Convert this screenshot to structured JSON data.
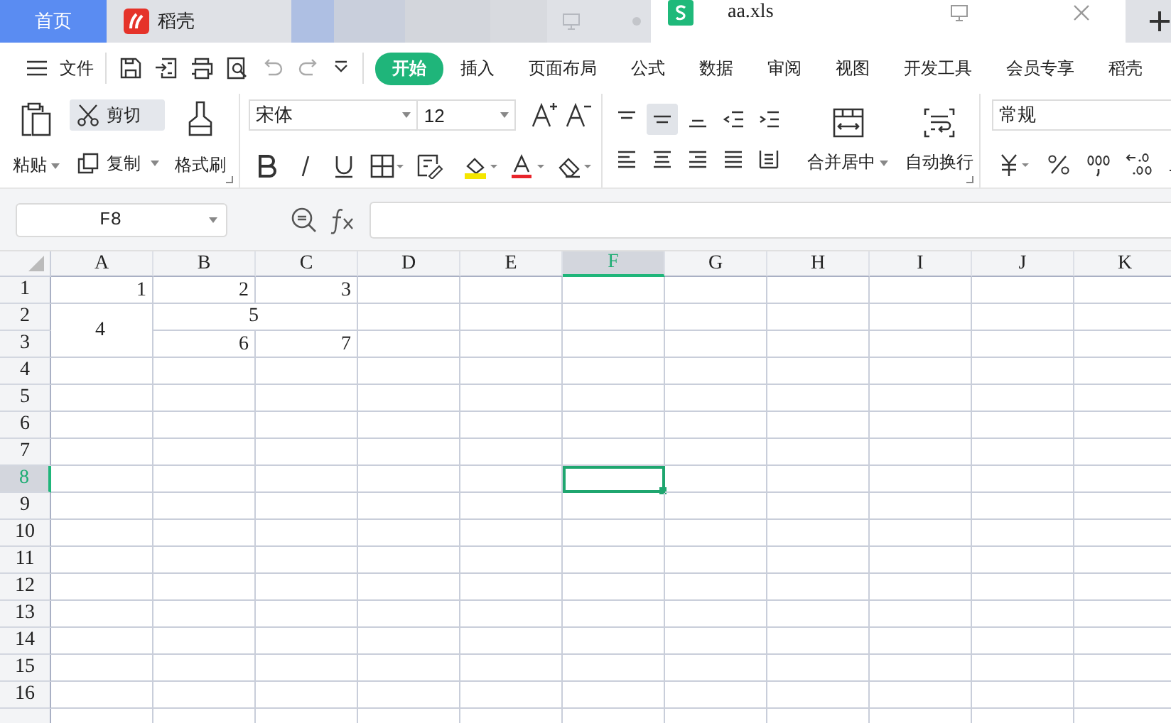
{
  "tabs": [
    {
      "kind": "home",
      "label": "首页",
      "selected": false
    },
    {
      "kind": "app",
      "label": "稻壳",
      "selected": false
    },
    {
      "kind": "blurred",
      "selected": false
    },
    {
      "kind": "sheet",
      "label": "aa.xls",
      "selected": true
    }
  ],
  "menu": {
    "file": "文件",
    "tabs": [
      {
        "label": "开始",
        "selected": true
      },
      {
        "label": "插入",
        "selected": false
      },
      {
        "label": "页面布局",
        "selected": false
      },
      {
        "label": "公式",
        "selected": false
      },
      {
        "label": "数据",
        "selected": false
      },
      {
        "label": "审阅",
        "selected": false
      },
      {
        "label": "视图",
        "selected": false
      },
      {
        "label": "开发工具",
        "selected": false
      },
      {
        "label": "会员专享",
        "selected": false
      },
      {
        "label": "稻壳",
        "selected": false
      }
    ]
  },
  "ribbon": {
    "paste": "粘贴",
    "cut": {
      "label": "剪切",
      "highlighted": true
    },
    "copy": "复制",
    "format_painter": "格式刷",
    "font": "宋体",
    "size": "12",
    "vertical_align": [
      {
        "selected": false
      },
      {
        "selected": true
      },
      {
        "selected": false
      }
    ],
    "merge": "合并居中",
    "wrap": "自动换行",
    "number_format": "常规"
  },
  "formula_bar": {
    "name_box": "F8"
  },
  "sheet": {
    "columns": [
      {
        "label": "A",
        "selected": false
      },
      {
        "label": "B",
        "selected": false
      },
      {
        "label": "C",
        "selected": false
      },
      {
        "label": "D",
        "selected": false
      },
      {
        "label": "E",
        "selected": false
      },
      {
        "label": "F",
        "selected": true
      },
      {
        "label": "G",
        "selected": false
      },
      {
        "label": "H",
        "selected": false
      },
      {
        "label": "I",
        "selected": false
      },
      {
        "label": "J",
        "selected": false
      },
      {
        "label": "K",
        "selected": false
      }
    ],
    "rows": [
      {
        "label": "1",
        "selected": false,
        "cells": [
          {
            "text": "1"
          },
          {
            "text": "2"
          },
          {
            "text": "3"
          }
        ]
      },
      {
        "label": "2",
        "selected": false,
        "cells": [
          {
            "text": "4",
            "kind": "merged_down"
          },
          {
            "text": "5",
            "kind": "merged_across"
          }
        ]
      },
      {
        "label": "3",
        "selected": false,
        "cells": [
          {
            "text": "6"
          },
          {
            "text": "7"
          }
        ]
      },
      {
        "label": "4",
        "selected": false
      },
      {
        "label": "5",
        "selected": false
      },
      {
        "label": "6",
        "selected": false
      },
      {
        "label": "7",
        "selected": false
      },
      {
        "label": "8",
        "selected": true
      },
      {
        "label": "9",
        "selected": false
      },
      {
        "label": "10",
        "selected": false
      },
      {
        "label": "11",
        "selected": false
      },
      {
        "label": "12",
        "selected": false
      },
      {
        "label": "13",
        "selected": false
      },
      {
        "label": "14",
        "selected": false
      },
      {
        "label": "15",
        "selected": false
      },
      {
        "label": "16",
        "selected": false
      }
    ]
  }
}
